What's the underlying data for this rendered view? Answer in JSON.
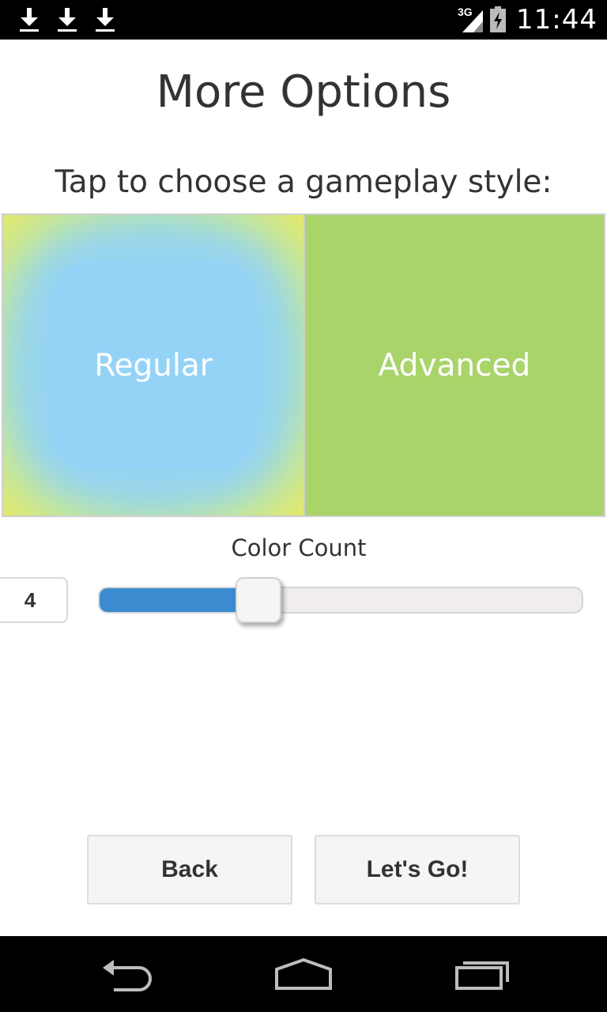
{
  "status_bar": {
    "notifications": [
      "download-icon",
      "download-icon",
      "download-icon"
    ],
    "network_type": "3G",
    "time": "11:44"
  },
  "page": {
    "title": "More Options",
    "subtitle": "Tap to choose a gameplay style:"
  },
  "gameplay_styles": {
    "regular_label": "Regular",
    "advanced_label": "Advanced",
    "regular_color": "#94d2f7",
    "advanced_color": "#a8d46a",
    "regular_border_color": "#e4e96a"
  },
  "color_count": {
    "label": "Color Count",
    "value": "4",
    "fill_fraction": 0.33,
    "fill_color": "#3b8bd0"
  },
  "buttons": {
    "back_label": "Back",
    "go_label": "Let's Go!"
  },
  "nav_bar": {
    "items": [
      "back-icon",
      "home-icon",
      "recent-apps-icon"
    ]
  }
}
